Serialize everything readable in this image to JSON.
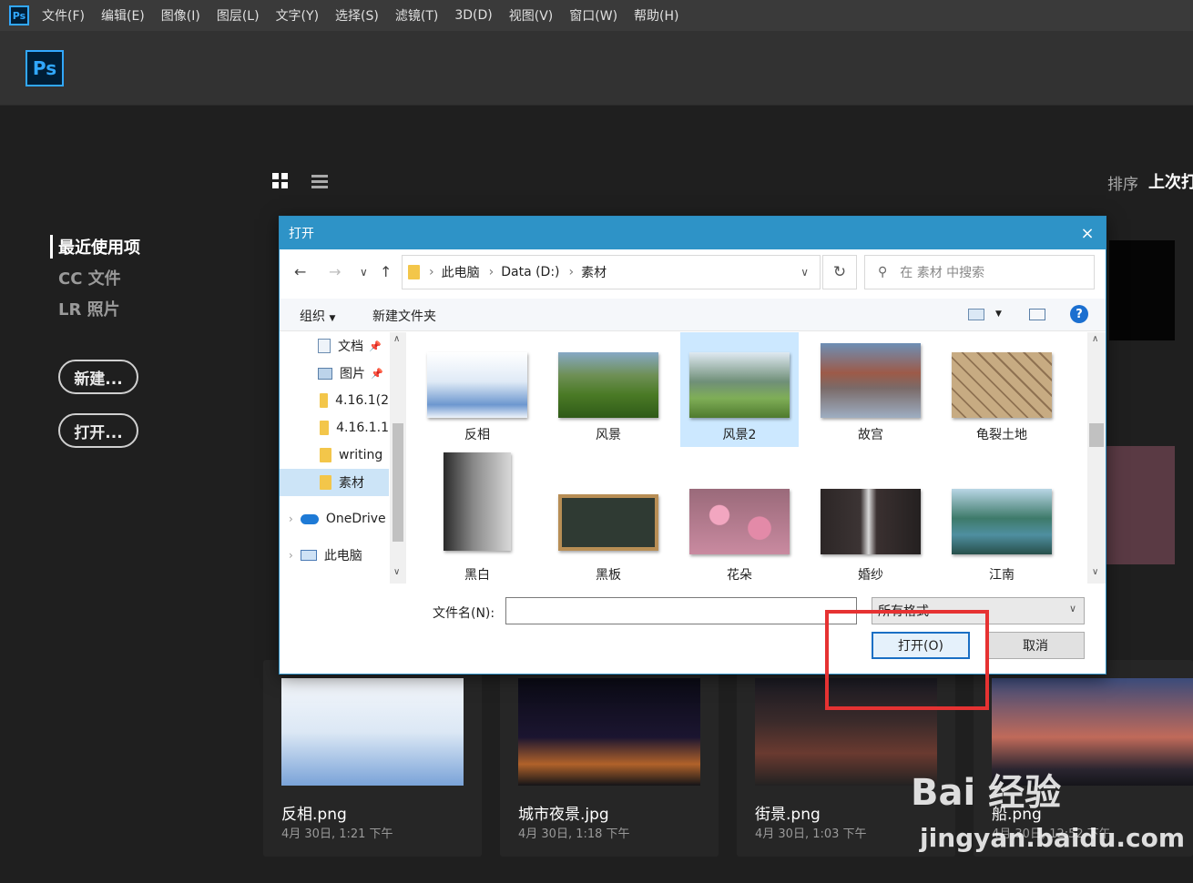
{
  "menubar": {
    "logo": "Ps",
    "items": [
      "文件(F)",
      "编辑(E)",
      "图像(I)",
      "图层(L)",
      "文字(Y)",
      "选择(S)",
      "滤镜(T)",
      "3D(D)",
      "视图(V)",
      "窗口(W)",
      "帮助(H)"
    ]
  },
  "app_logo": "Ps",
  "home": {
    "nav": [
      "最近使用项",
      "CC 文件",
      "LR 照片"
    ],
    "new_button": "新建...",
    "open_button": "打开...",
    "sort_label": "排序",
    "sort_value": "上次打"
  },
  "recent_files": [
    {
      "name": "反相.png",
      "date": "4月 30日, 1:21 下午"
    },
    {
      "name": "城市夜景.jpg",
      "date": "4月 30日, 1:18 下午"
    },
    {
      "name": "街景.png",
      "date": "4月 30日, 1:03 下午"
    },
    {
      "name": "船.png",
      "date": "4月 30日, 12:52 下午"
    }
  ],
  "dialog": {
    "title": "打开",
    "close_icon": "×",
    "breadcrumb": [
      "此电脑",
      "Data (D:)",
      "素材"
    ],
    "search_placeholder": "在 素材 中搜索",
    "toolbar": {
      "organize": "组织",
      "new_folder": "新建文件夹",
      "help": "?"
    },
    "tree": [
      {
        "label": "文档",
        "icon": "doc"
      },
      {
        "label": "图片",
        "icon": "pic"
      },
      {
        "label": "4.16.1(2",
        "icon": "folder"
      },
      {
        "label": "4.16.1.1",
        "icon": "folder"
      },
      {
        "label": "writing",
        "icon": "folder"
      },
      {
        "label": "素材",
        "icon": "folder",
        "selected": true
      },
      {
        "label": "OneDrive",
        "icon": "cloud"
      },
      {
        "label": "此电脑",
        "icon": "pc"
      }
    ],
    "files": [
      {
        "label": "反相",
        "color": "#b8d4f0"
      },
      {
        "label": "风景",
        "color": "#5a8a32"
      },
      {
        "label": "风景2",
        "color": "#6e9e55",
        "selected": true
      },
      {
        "label": "故宫",
        "color": "#a86858"
      },
      {
        "label": "龟裂土地",
        "color": "#b89a72"
      },
      {
        "label": "黑白",
        "color": "#555555"
      },
      {
        "label": "黑板",
        "color": "#2f3a33"
      },
      {
        "label": "花朵",
        "color": "#d887a0"
      },
      {
        "label": "婚纱",
        "color": "#3a3434"
      },
      {
        "label": "江南",
        "color": "#5a9aa8"
      }
    ],
    "filename_label": "文件名(N):",
    "filename_value": "",
    "filter": "所有格式",
    "open_button": "打开(O)",
    "cancel_button": "取消"
  },
  "watermark": {
    "brand": "Bai 经验",
    "url": "jingyan.baidu.com"
  }
}
